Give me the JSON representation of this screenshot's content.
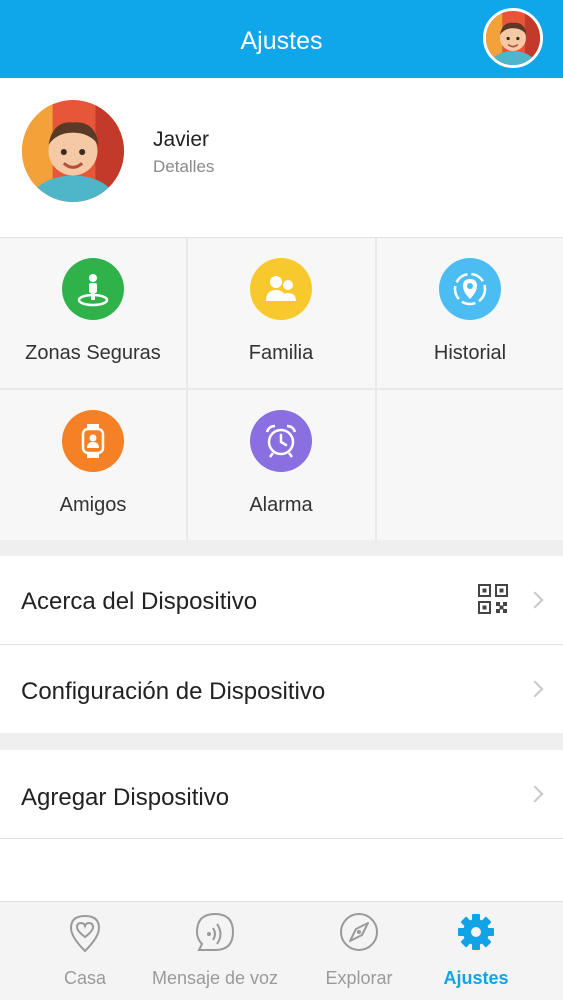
{
  "header": {
    "title": "Ajustes",
    "avatar_icon": "child-avatar"
  },
  "profile": {
    "name": "Javier",
    "details": "Detalles",
    "avatar_icon": "child-avatar"
  },
  "features": [
    {
      "label": "Zonas Seguras",
      "icon": "location-pin-icon",
      "color": "#2fb24a"
    },
    {
      "label": "Familia",
      "icon": "family-icon",
      "color": "#f8c92c"
    },
    {
      "label": "Historial",
      "icon": "history-map-icon",
      "color": "#4cbdf3"
    },
    {
      "label": "Amigos",
      "icon": "watch-friend-icon",
      "color": "#f58025"
    },
    {
      "label": "Alarma",
      "icon": "alarm-clock-icon",
      "color": "#8a6fe0"
    }
  ],
  "menu": [
    {
      "label": "Acerca del Dispositivo",
      "icon": "qr-code-icon"
    },
    {
      "label": "Configuración de Dispositivo"
    },
    {
      "label": "Agregar Dispositivo"
    }
  ],
  "tabs": [
    {
      "label": "Casa",
      "icon": "heart-pin-icon",
      "active": false
    },
    {
      "label": "Mensaje de voz",
      "icon": "voice-message-icon",
      "active": false
    },
    {
      "label": "Explorar",
      "icon": "compass-icon",
      "active": false
    },
    {
      "label": "Ajustes",
      "icon": "gear-icon",
      "active": true
    }
  ],
  "colors": {
    "accent": "#10a6ea",
    "active_tab": "#11a3e6"
  }
}
